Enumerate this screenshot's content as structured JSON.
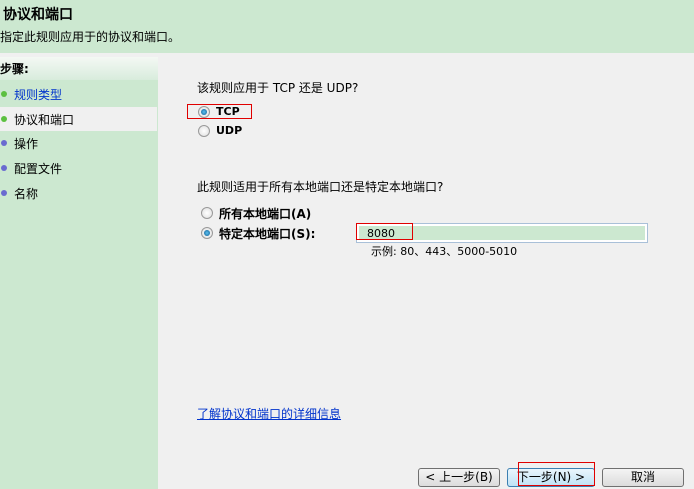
{
  "header": {
    "title": "协议和端口",
    "subtitle": "指定此规则应用于的协议和端口。"
  },
  "steps": {
    "heading": "步骤:",
    "items": [
      {
        "label": "规则类型",
        "state": "done"
      },
      {
        "label": "协议和端口",
        "state": "current"
      },
      {
        "label": "操作",
        "state": "pending"
      },
      {
        "label": "配置文件",
        "state": "pending"
      },
      {
        "label": "名称",
        "state": "pending"
      }
    ]
  },
  "protocol": {
    "question": "该规则应用于 TCP 还是 UDP?",
    "options": [
      "TCP",
      "UDP"
    ],
    "selected": "TCP"
  },
  "ports": {
    "question": "此规则适用于所有本地端口还是特定本地端口?",
    "all_label": "所有本地端口(A)",
    "specific_label": "特定本地端口(S):",
    "value": "8080",
    "example": "示例: 80、443、5000-5010"
  },
  "help_link": "了解协议和端口的详细信息",
  "buttons": {
    "back": "< 上一步(B)",
    "next": "下一步(N) >",
    "cancel": "取消"
  },
  "colors": {
    "panel": "#cce8d0",
    "link": "#0033cc",
    "highlight": "#e00000"
  }
}
